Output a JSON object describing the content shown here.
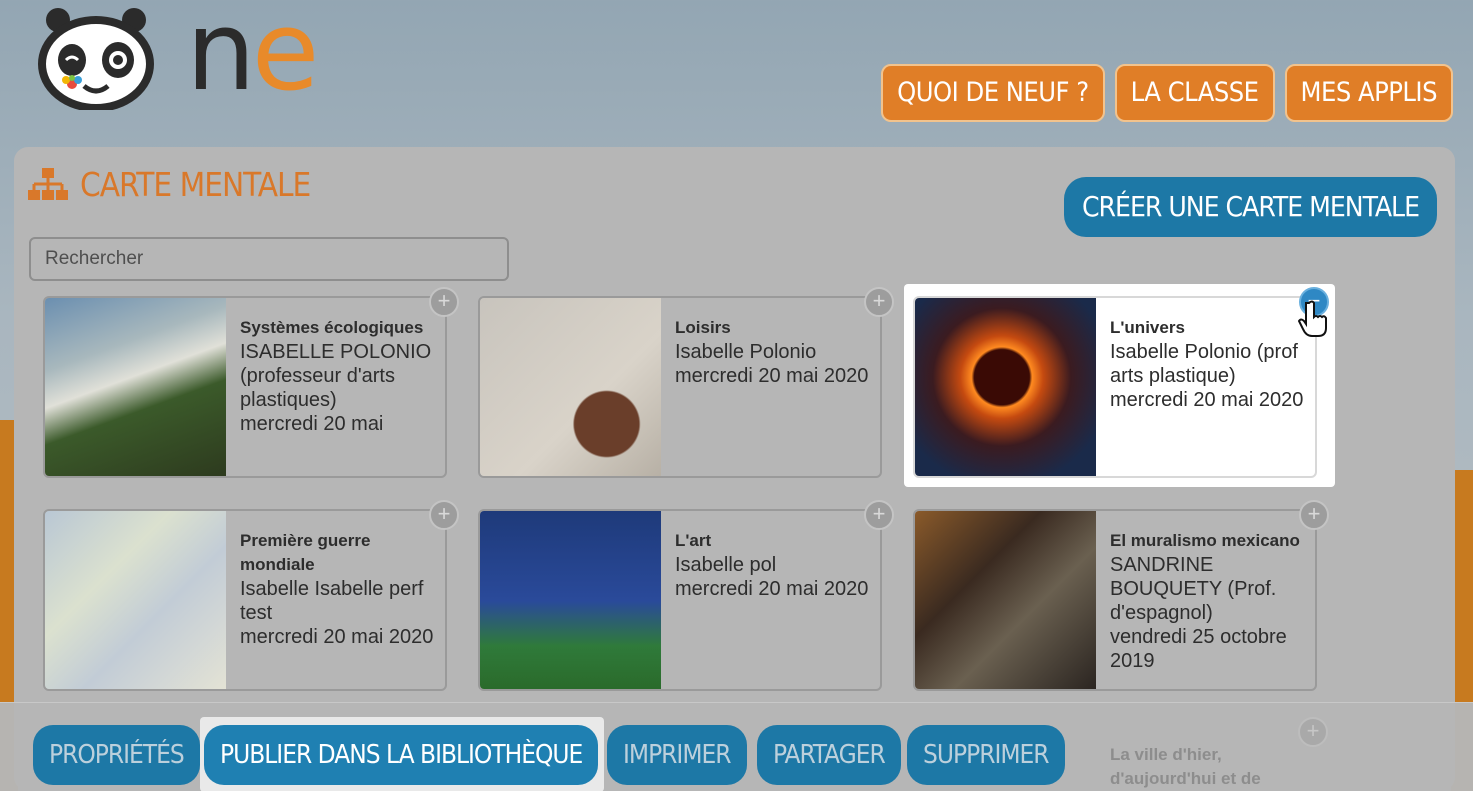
{
  "header": {
    "logo_text": "ne",
    "nav": [
      "QUOI DE NEUF ?",
      "LA CLASSE",
      "MES APPLIS"
    ]
  },
  "page": {
    "title": "CARTE MENTALE",
    "create_button": "CRÉER UNE CARTE MENTALE",
    "search_placeholder": "Rechercher"
  },
  "cards": [
    {
      "title": "Systèmes écologiques",
      "author": "ISABELLE POLONIO (professeur d'arts plastiques)",
      "date": "mercredi 20 mai",
      "toggle": "+"
    },
    {
      "title": "Loisirs",
      "author": "Isabelle Polonio",
      "date": "mercredi 20 mai 2020",
      "toggle": "+"
    },
    {
      "title": "L'univers",
      "author": "Isabelle Polonio (prof arts plastique)",
      "date": "mercredi 20 mai 2020",
      "toggle": "−"
    },
    {
      "title": "Première guerre mondiale",
      "author": "Isabelle Isabelle perf test",
      "date": "mercredi 20 mai 2020",
      "toggle": "+"
    },
    {
      "title": "L'art",
      "author": "Isabelle pol",
      "date": "mercredi 20 mai 2020",
      "toggle": "+"
    },
    {
      "title": "El muralismo mexicano",
      "author": "SANDRINE BOUQUETY (Prof. d'espagnol)",
      "date": "vendredi 25 octobre 2019",
      "toggle": "+"
    }
  ],
  "peek_card": {
    "title": "La ville d'hier, d'aujourd'hui et de"
  },
  "toolbar": {
    "buttons": [
      "PROPRIÉTÉS",
      "PUBLIER DANS LA BIBLIOTHÈQUE",
      "IMPRIMER",
      "PARTAGER",
      "SUPPRIMER"
    ]
  },
  "colors": {
    "accent_orange": "#e07e27",
    "accent_blue": "#1d78a6"
  }
}
